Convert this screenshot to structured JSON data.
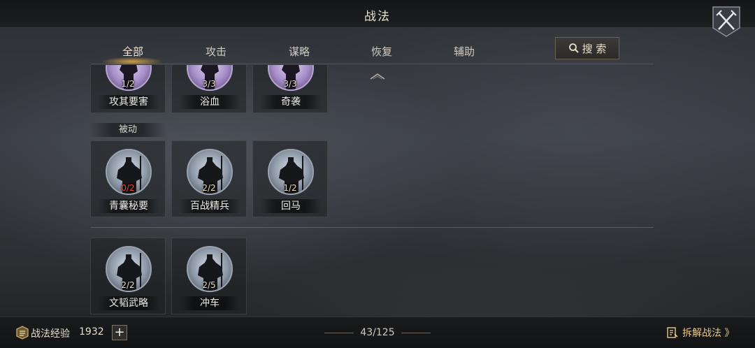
{
  "header": {
    "title": "战法",
    "close_icon": "crossed-swords-icon"
  },
  "tabs": [
    {
      "label": "全部",
      "active": true
    },
    {
      "label": "攻击",
      "active": false
    },
    {
      "label": "谋略",
      "active": false
    },
    {
      "label": "恢复",
      "active": false
    },
    {
      "label": "辅助",
      "active": false
    }
  ],
  "search": {
    "label": "搜 索",
    "icon": "search-icon"
  },
  "sections": {
    "passive_label": "被动"
  },
  "cards": [
    {
      "name": "攻其要害",
      "count": "1/2",
      "style": "purple"
    },
    {
      "name": "浴血",
      "count": "3/3",
      "style": "purple"
    },
    {
      "name": "奇袭",
      "count": "3/3",
      "style": "purple"
    },
    {
      "name": "青囊秘要",
      "count": "0/2",
      "style": "blue",
      "count_color": "red"
    },
    {
      "name": "百战精兵",
      "count": "2/2",
      "style": "blue"
    },
    {
      "name": "回马",
      "count": "1/2",
      "style": "blue"
    },
    {
      "name": "文韬武略",
      "count": "2/2",
      "style": "blue"
    },
    {
      "name": "冲车",
      "count": "2/5",
      "style": "blue"
    }
  ],
  "footer": {
    "exp_label": "战法经验",
    "exp_value": "1932",
    "plus_label": "+",
    "page_count": "43/125",
    "dismantle_label": "拆解战法 》"
  },
  "colors": {
    "accent_gold": "#e8b046",
    "count_red": "#e04b3a",
    "purple_ring": "#b6a6cf",
    "blue_ring": "#9aa3b0"
  }
}
